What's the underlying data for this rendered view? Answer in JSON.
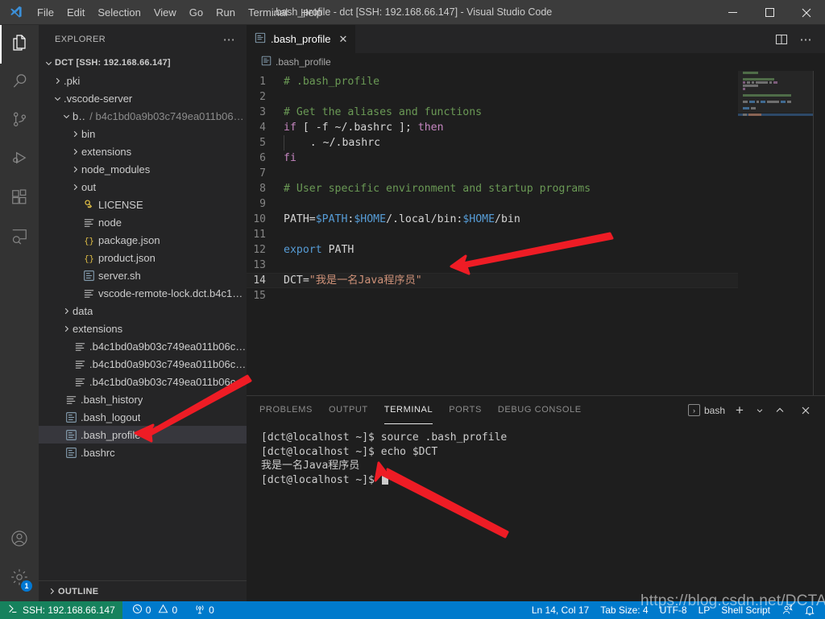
{
  "window": {
    "title": ".bash_profile - dct [SSH: 192.168.66.147] - Visual Studio Code",
    "minimize_label": "─",
    "maximize_label": "□",
    "close_label": "✕"
  },
  "menubar": [
    {
      "label": "File"
    },
    {
      "label": "Edit"
    },
    {
      "label": "Selection"
    },
    {
      "label": "View"
    },
    {
      "label": "Go"
    },
    {
      "label": "Run"
    },
    {
      "label": "Terminal"
    },
    {
      "label": "Help"
    }
  ],
  "activitybar": {
    "items": [
      {
        "name": "explorer",
        "icon": "files-icon",
        "active": true
      },
      {
        "name": "search",
        "icon": "search-icon",
        "active": false
      },
      {
        "name": "source-control",
        "icon": "source-control-icon",
        "active": false
      },
      {
        "name": "run-and-debug",
        "icon": "run-debug-icon",
        "active": false
      },
      {
        "name": "extensions",
        "icon": "extensions-icon",
        "active": false
      },
      {
        "name": "remote-explorer",
        "icon": "remote-explorer-icon",
        "active": false
      }
    ],
    "accounts_icon": "account-icon",
    "settings_icon": "gear-icon",
    "settings_badge": "1"
  },
  "sidebar": {
    "title": "EXPLORER",
    "more_actions": "⋯",
    "outline_label": "OUTLINE",
    "tree": [
      {
        "label": "DCT [SSH: 192.168.66.147]",
        "indent": 0,
        "kind": "root",
        "twisty": "down",
        "icon": "none"
      },
      {
        "label": ".pki",
        "indent": 1,
        "kind": "folder",
        "twisty": "right",
        "icon": "none"
      },
      {
        "label": ".vscode-server",
        "indent": 1,
        "kind": "folder",
        "twisty": "down",
        "icon": "none"
      },
      {
        "label": "bin",
        "sublabel": "/ b4c1bd0a9b03c749ea011b06c...",
        "indent": 2,
        "kind": "folder",
        "twisty": "down",
        "icon": "none"
      },
      {
        "label": "bin",
        "indent": 3,
        "kind": "folder",
        "twisty": "right",
        "icon": "none"
      },
      {
        "label": "extensions",
        "indent": 3,
        "kind": "folder",
        "twisty": "right",
        "icon": "none"
      },
      {
        "label": "node_modules",
        "indent": 3,
        "kind": "folder",
        "twisty": "right",
        "icon": "none"
      },
      {
        "label": "out",
        "indent": 3,
        "kind": "folder",
        "twisty": "right",
        "icon": "none"
      },
      {
        "label": "LICENSE",
        "indent": 3,
        "kind": "file",
        "twisty": "none",
        "icon": "license-icon"
      },
      {
        "label": "node",
        "indent": 3,
        "kind": "file",
        "twisty": "none",
        "icon": "binary-icon"
      },
      {
        "label": "package.json",
        "indent": 3,
        "kind": "file",
        "twisty": "none",
        "icon": "json-icon"
      },
      {
        "label": "product.json",
        "indent": 3,
        "kind": "file",
        "twisty": "none",
        "icon": "json-icon"
      },
      {
        "label": "server.sh",
        "indent": 3,
        "kind": "file",
        "twisty": "none",
        "icon": "shell-icon"
      },
      {
        "label": "vscode-remote-lock.dct.b4c1bd0a...",
        "indent": 3,
        "kind": "file",
        "twisty": "none",
        "icon": "binary-icon"
      },
      {
        "label": "data",
        "indent": 2,
        "kind": "folder",
        "twisty": "right",
        "icon": "none"
      },
      {
        "label": "extensions",
        "indent": 2,
        "kind": "folder",
        "twisty": "right",
        "icon": "none"
      },
      {
        "label": ".b4c1bd0a9b03c749ea011b06c6d2...",
        "indent": 2,
        "kind": "file",
        "twisty": "none",
        "icon": "binary-icon"
      },
      {
        "label": ".b4c1bd0a9b03c749ea011b06c6d2...",
        "indent": 2,
        "kind": "file",
        "twisty": "none",
        "icon": "binary-icon"
      },
      {
        "label": ".b4c1bd0a9b03c749ea011b06c6d2...",
        "indent": 2,
        "kind": "file",
        "twisty": "none",
        "icon": "binary-icon"
      },
      {
        "label": ".bash_history",
        "indent": 1,
        "kind": "file",
        "twisty": "none",
        "icon": "binary-icon"
      },
      {
        "label": ".bash_logout",
        "indent": 1,
        "kind": "file",
        "twisty": "none",
        "icon": "shell-icon"
      },
      {
        "label": ".bash_profile",
        "indent": 1,
        "kind": "file",
        "twisty": "none",
        "icon": "shell-icon",
        "selected": true
      },
      {
        "label": ".bashrc",
        "indent": 1,
        "kind": "file",
        "twisty": "none",
        "icon": "shell-icon"
      }
    ]
  },
  "editor": {
    "tab": {
      "label": ".bash_profile",
      "close": "✕",
      "icon": "shell-file-icon"
    },
    "actions": {
      "split": "split-editor-icon",
      "more": "⋯"
    },
    "breadcrumb": ".bash_profile",
    "lines": [
      {
        "n": 1,
        "tokens": [
          {
            "t": "# .bash_profile",
            "c": "tk-cmt"
          }
        ]
      },
      {
        "n": 2,
        "tokens": []
      },
      {
        "n": 3,
        "tokens": [
          {
            "t": "# Get the aliases and functions",
            "c": "tk-cmt"
          }
        ]
      },
      {
        "n": 4,
        "tokens": [
          {
            "t": "if",
            "c": "tk-kw"
          },
          {
            "t": " [ ",
            "c": "tk-pl"
          },
          {
            "t": "-f",
            "c": "tk-pl"
          },
          {
            "t": " ~/.bashrc ]",
            "c": "tk-pl"
          },
          {
            "t": "; ",
            "c": "tk-pl"
          },
          {
            "t": "then",
            "c": "tk-kw"
          }
        ]
      },
      {
        "n": 5,
        "tokens": [
          {
            "t": "    . ~/.bashrc",
            "c": "tk-pl"
          }
        ],
        "guide": true
      },
      {
        "n": 6,
        "tokens": [
          {
            "t": "fi",
            "c": "tk-kw"
          }
        ]
      },
      {
        "n": 7,
        "tokens": []
      },
      {
        "n": 8,
        "tokens": [
          {
            "t": "# User specific environment and startup programs",
            "c": "tk-cmt"
          }
        ]
      },
      {
        "n": 9,
        "tokens": []
      },
      {
        "n": 10,
        "tokens": [
          {
            "t": "PATH=",
            "c": "tk-pl"
          },
          {
            "t": "$PATH",
            "c": "tk-fn"
          },
          {
            "t": ":",
            "c": "tk-pl"
          },
          {
            "t": "$HOME",
            "c": "tk-fn"
          },
          {
            "t": "/.local/bin:",
            "c": "tk-pl"
          },
          {
            "t": "$HOME",
            "c": "tk-fn"
          },
          {
            "t": "/bin",
            "c": "tk-pl"
          }
        ]
      },
      {
        "n": 11,
        "tokens": []
      },
      {
        "n": 12,
        "tokens": [
          {
            "t": "export",
            "c": "tk-fn"
          },
          {
            "t": " PATH",
            "c": "tk-pl"
          }
        ]
      },
      {
        "n": 13,
        "tokens": []
      },
      {
        "n": 14,
        "tokens": [
          {
            "t": "DCT=",
            "c": "tk-pl"
          },
          {
            "t": "\"我是一名Java程序员\"",
            "c": "tk-str"
          }
        ],
        "active": true
      },
      {
        "n": 15,
        "tokens": []
      }
    ]
  },
  "panel": {
    "tabs": [
      {
        "label": "PROBLEMS",
        "active": false
      },
      {
        "label": "OUTPUT",
        "active": false
      },
      {
        "label": "TERMINAL",
        "active": true
      },
      {
        "label": "PORTS",
        "active": false
      },
      {
        "label": "DEBUG CONSOLE",
        "active": false
      }
    ],
    "terminal_name": "bash",
    "terminal_chip": "›",
    "new_terminal": "+",
    "new_terminal_dropdown": "⌄",
    "maximize": "⌃",
    "close": "✕",
    "terminal_lines": [
      "[dct@localhost ~]$ source .bash_profile",
      "[dct@localhost ~]$ echo $DCT",
      "我是一名Java程序员",
      "[dct@localhost ~]$ "
    ]
  },
  "statusbar": {
    "remote": "SSH: 192.168.66.147",
    "errors": "0",
    "warnings": "0",
    "ports": "0",
    "position": "Ln 14, Col 17",
    "tab_size": "Tab Size: 4",
    "encoding": "UTF-8",
    "eol": "LP",
    "language": "Shell Script",
    "feedback_icon": "feedback-icon",
    "bell_icon": "bell-icon"
  },
  "watermark": "https://blog.csdn.net/DCTANT",
  "colors": {
    "accent": "#007acc",
    "remote_green": "#16825d",
    "editor_bg": "#1e1e1e",
    "sidebar_bg": "#252526",
    "titlebar_bg": "#3c3c3c",
    "annotation_red": "#ee1c25"
  }
}
